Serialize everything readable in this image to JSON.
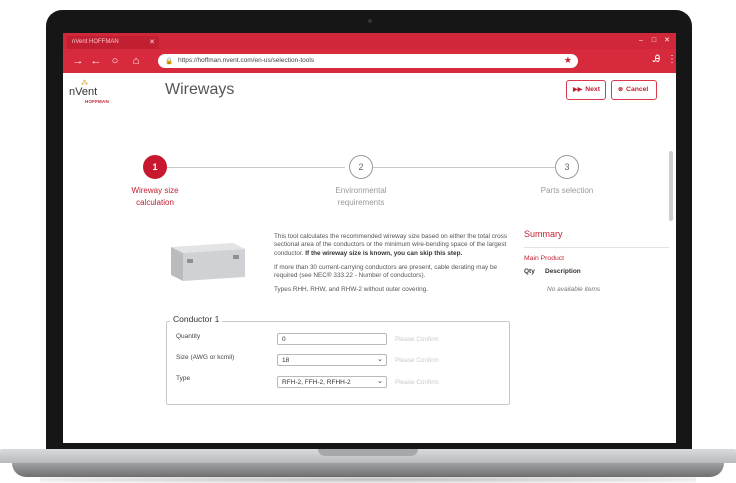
{
  "browser": {
    "tab_title": "nVent HOFFMAN",
    "url": "https://hoffman.nvent.com/en-us/selection-tools"
  },
  "header": {
    "logo_text": "nVent",
    "logo_sub": "HOFFMAN",
    "title": "Wireways",
    "next_label": "Next",
    "cancel_label": "Cancel"
  },
  "steps": [
    {
      "number": "1",
      "label_line1": "Wireway size",
      "label_line2": "calculation",
      "active": true
    },
    {
      "number": "2",
      "label_line1": "Environmental",
      "label_line2": "requirements",
      "active": false
    },
    {
      "number": "3",
      "label_line1": "Parts selection",
      "label_line2": "",
      "active": false
    }
  ],
  "intro": {
    "p1": "This tool calculates the recommended wireway size based on either the total cross sectional area of the conductors or the minimum wire-bending space of the largest conductor.",
    "p1_bold": "If the wireway size is known, you can skip this step.",
    "p2": "If more than 30 current-carrying conductors are present, cable derating may be required (see NEC® 333.22 - Number of conductors).",
    "p3": "Types RHH, RHW, and RHW-2 without outer covering."
  },
  "summary": {
    "title": "Summary",
    "main_product": "Main Product",
    "col_qty": "Qty",
    "col_desc": "Description",
    "empty": "No available items"
  },
  "conductor": {
    "legend": "Conductor 1",
    "quantity_label": "Quantity",
    "quantity_value": "0",
    "size_label": "Size (AWG or kcmil)",
    "size_value": "18",
    "type_label": "Type",
    "type_value": "RFH-2, FFH-2, RFHH-2",
    "confirm_label": "Please Confirm"
  },
  "colors": {
    "brand_red": "#c8182f",
    "chrome_red": "#d72a3d"
  }
}
